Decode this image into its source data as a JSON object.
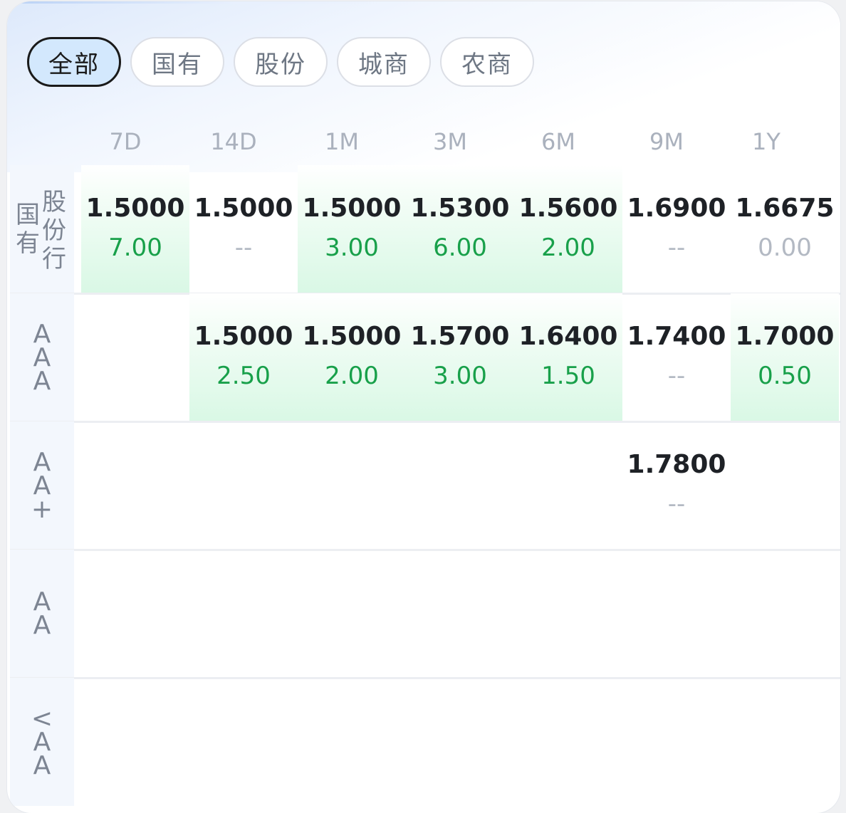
{
  "tabs": [
    {
      "label": "全部",
      "active": true
    },
    {
      "label": "国有",
      "active": false
    },
    {
      "label": "股份",
      "active": false
    },
    {
      "label": "城商",
      "active": false
    },
    {
      "label": "农商",
      "active": false
    }
  ],
  "columns": [
    "7D",
    "14D",
    "1M",
    "3M",
    "6M",
    "9M",
    "1Y"
  ],
  "rows": [
    {
      "label_col1": [
        "国",
        "有"
      ],
      "label_col2": [
        "股",
        "份",
        "行"
      ],
      "cells": [
        {
          "rate": "1.5000",
          "amount": "7.00",
          "filled": true,
          "muted": false
        },
        {
          "rate": "1.5000",
          "amount": "--",
          "filled": false,
          "muted": true
        },
        {
          "rate": "1.5000",
          "amount": "3.00",
          "filled": true,
          "muted": false
        },
        {
          "rate": "1.5300",
          "amount": "6.00",
          "filled": true,
          "muted": false
        },
        {
          "rate": "1.5600",
          "amount": "2.00",
          "filled": true,
          "muted": false
        },
        {
          "rate": "1.6900",
          "amount": "--",
          "filled": false,
          "muted": true
        },
        {
          "rate": "1.6675",
          "amount": "0.00",
          "filled": false,
          "muted": true
        }
      ]
    },
    {
      "label_chars": [
        "A",
        "A",
        "A"
      ],
      "cells": [
        null,
        {
          "rate": "1.5000",
          "amount": "2.50",
          "filled": true,
          "muted": false
        },
        {
          "rate": "1.5000",
          "amount": "2.00",
          "filled": true,
          "muted": false
        },
        {
          "rate": "1.5700",
          "amount": "3.00",
          "filled": true,
          "muted": false
        },
        {
          "rate": "1.6400",
          "amount": "1.50",
          "filled": true,
          "muted": false
        },
        {
          "rate": "1.7400",
          "amount": "--",
          "filled": false,
          "muted": true
        },
        {
          "rate": "1.7000",
          "amount": "0.50",
          "filled": true,
          "muted": false
        }
      ]
    },
    {
      "label_chars": [
        "A",
        "A",
        "+"
      ],
      "cells": [
        null,
        null,
        null,
        null,
        null,
        {
          "rate": "1.7800",
          "amount": "--",
          "filled": false,
          "muted": true
        },
        null
      ]
    },
    {
      "label_chars": [
        "A",
        "A"
      ],
      "cells": [
        null,
        null,
        null,
        null,
        null,
        null,
        null
      ]
    },
    {
      "label_chars": [
        "<",
        "A",
        "A"
      ],
      "cells": [
        null,
        null,
        null,
        null,
        null,
        null,
        null
      ]
    }
  ]
}
